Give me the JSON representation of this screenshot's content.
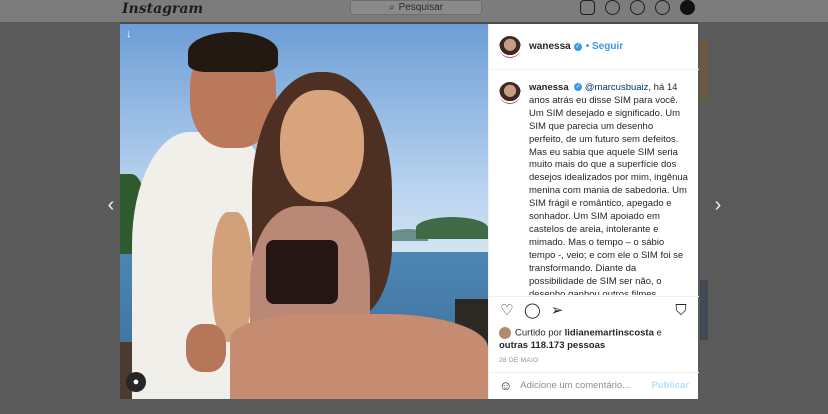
{
  "nav": {
    "logo": "Instagram",
    "search_placeholder": "Pesquisar",
    "icons": [
      "home-icon",
      "messenger-icon",
      "explore-icon",
      "heart-icon",
      "profile-avatar"
    ]
  },
  "modal": {
    "username": "wanessa",
    "follow_label": "Seguir",
    "caption": {
      "username": "wanessa",
      "mention": "@marcusbuaiz",
      "text": ", há 14 anos atrás eu disse SIM para você. Um SIM desejado e significado. Um SIM que parecia um desenho perfeito, de um futuro sem defeitos. Mas eu sabia que aquele SIM seria muito mais do que a superfície dos desejos idealizados por mim, ingênua menina com mania de sabedoria. Um SIM frágil e romântico, apegado e sonhador. Um SIM apoiado em castelos de areia, intolerante e mimado. Mas o tempo – o sábio tempo -, veio; e com ele o SIM foi se transformando. Diante da possibilidade de SIM ser não, o desenho ganhou outros filmes imperfeitos de um futuro cheio de defeitos. A superfície ganhou"
    },
    "likes": {
      "prefix": "Curtido por",
      "liker": "lidianemartinscosta",
      "connector": "e",
      "others": "outras 118.173 pessoas"
    },
    "date": "28 DE MAIO",
    "comment_placeholder": "Adicione um comentário...",
    "publish_label": "Publicar"
  },
  "colors": {
    "accent": "#3897f0",
    "publish_disabled": "#b2dffc",
    "overlay": "#5a5a5a"
  }
}
